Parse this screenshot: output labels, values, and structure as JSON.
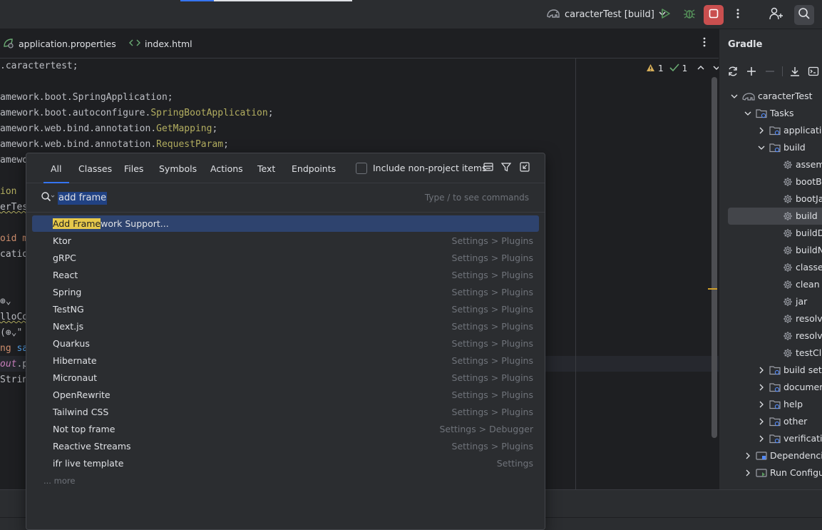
{
  "toolbar": {
    "run_config": "caracterTest [build]"
  },
  "editor_tabs": [
    {
      "label": "application.properties"
    },
    {
      "label": "index.html"
    }
  ],
  "editor": {
    "inspections": {
      "warnings": "1",
      "ok": "1"
    },
    "lines": [
      [
        {
          "t": ".caractertest;",
          "c": ""
        }
      ],
      [
        {
          "t": "",
          "c": ""
        }
      ],
      [
        {
          "t": "amework.boot.SpringApplication;",
          "c": ""
        }
      ],
      [
        {
          "t": "amework.boot.autoconfigure.",
          "c": ""
        },
        {
          "t": "SpringBootApplication",
          "c": "ann"
        },
        {
          "t": ";",
          "c": ""
        }
      ],
      [
        {
          "t": "amework.web.bind.annotation.",
          "c": ""
        },
        {
          "t": "GetMapping",
          "c": "ann"
        },
        {
          "t": ";",
          "c": ""
        }
      ],
      [
        {
          "t": "amework.web.bind.annotation.",
          "c": ""
        },
        {
          "t": "RequestParam",
          "c": "ann"
        },
        {
          "t": ";",
          "c": ""
        }
      ],
      [
        {
          "t": "amewo",
          "c": ""
        }
      ],
      [
        {
          "t": "",
          "c": ""
        }
      ],
      [
        {
          "t": "ion",
          "c": "ann"
        }
      ],
      [
        {
          "t": "erTes",
          "c": "wavy"
        }
      ],
      [
        {
          "t": "",
          "c": ""
        }
      ],
      [
        {
          "t": "oid m",
          "c": "kw"
        }
      ],
      [
        {
          "t": "catio",
          "c": ""
        }
      ],
      [
        {
          "t": "",
          "c": ""
        }
      ],
      [
        {
          "t": "",
          "c": ""
        }
      ],
      [
        {
          "t": "⊕⌄",
          "c": ""
        }
      ],
      [
        {
          "t": "lloCo",
          "c": "wavy"
        }
      ],
      [
        {
          "t": "(⊕⌄\"",
          "c": ""
        }
      ],
      [
        {
          "t": "ng ",
          "c": "kw"
        },
        {
          "t": "sa",
          "c": "fn"
        }
      ],
      [
        {
          "t": "out",
          "c": "fld"
        },
        {
          "t": ".p",
          "c": ""
        }
      ],
      [
        {
          "t": "Strin",
          "c": ""
        }
      ]
    ]
  },
  "gradle": {
    "title": "Gradle",
    "tree": [
      {
        "label": "caracterTest",
        "depth": 0,
        "arrow": "down",
        "icon": "gradle-elephant-icon"
      },
      {
        "label": "Tasks",
        "depth": 1,
        "arrow": "down",
        "icon": "folder-icon"
      },
      {
        "label": "application",
        "depth": 2,
        "arrow": "right",
        "icon": "folder-gear-icon"
      },
      {
        "label": "build",
        "depth": 2,
        "arrow": "down",
        "icon": "folder-gear-icon"
      },
      {
        "label": "assemble",
        "depth": 3,
        "arrow": "",
        "icon": "gear-icon"
      },
      {
        "label": "bootBuildImage",
        "depth": 3,
        "arrow": "",
        "icon": "gear-icon"
      },
      {
        "label": "bootJar",
        "depth": 3,
        "arrow": "",
        "icon": "gear-icon"
      },
      {
        "label": "build",
        "depth": 3,
        "arrow": "",
        "icon": "gear-icon",
        "selected": true
      },
      {
        "label": "buildDependents",
        "depth": 3,
        "arrow": "",
        "icon": "gear-icon"
      },
      {
        "label": "buildNeeded",
        "depth": 3,
        "arrow": "",
        "icon": "gear-icon"
      },
      {
        "label": "classes",
        "depth": 3,
        "arrow": "",
        "icon": "gear-icon"
      },
      {
        "label": "clean",
        "depth": 3,
        "arrow": "",
        "icon": "gear-icon"
      },
      {
        "label": "jar",
        "depth": 3,
        "arrow": "",
        "icon": "gear-icon"
      },
      {
        "label": "resolveMainClassName",
        "depth": 3,
        "arrow": "",
        "icon": "gear-icon"
      },
      {
        "label": "resolveTestMainClassName",
        "depth": 3,
        "arrow": "",
        "icon": "gear-icon"
      },
      {
        "label": "testClasses",
        "depth": 3,
        "arrow": "",
        "icon": "gear-icon"
      },
      {
        "label": "build setup",
        "depth": 2,
        "arrow": "right",
        "icon": "folder-gear-icon"
      },
      {
        "label": "documentation",
        "depth": 2,
        "arrow": "right",
        "icon": "folder-gear-icon"
      },
      {
        "label": "help",
        "depth": 2,
        "arrow": "right",
        "icon": "folder-gear-icon"
      },
      {
        "label": "other",
        "depth": 2,
        "arrow": "right",
        "icon": "folder-gear-icon"
      },
      {
        "label": "verification",
        "depth": 2,
        "arrow": "right",
        "icon": "folder-gear-icon"
      },
      {
        "label": "Dependencies",
        "depth": 1,
        "arrow": "right",
        "icon": "dependencies-icon"
      },
      {
        "label": "Run Configurations",
        "depth": 1,
        "arrow": "right",
        "icon": "run-configs-icon"
      }
    ]
  },
  "search_popup": {
    "tabs": [
      {
        "label": "All",
        "active": true
      },
      {
        "label": "Classes"
      },
      {
        "label": "Files"
      },
      {
        "label": "Symbols"
      },
      {
        "label": "Actions"
      },
      {
        "label": "Text"
      },
      {
        "label": "Endpoints"
      }
    ],
    "include_non_project_label": "Include non-project items",
    "include_non_project_checked": false,
    "query": "add frame",
    "hint": "Type / to see commands",
    "results": [
      {
        "hl": "Add Frame",
        "rest": "work Support...",
        "location": "",
        "selected": true
      },
      {
        "hl": "",
        "rest": "Ktor",
        "location": "Settings > Plugins"
      },
      {
        "hl": "",
        "rest": "gRPC",
        "location": "Settings > Plugins"
      },
      {
        "hl": "",
        "rest": "React",
        "location": "Settings > Plugins"
      },
      {
        "hl": "",
        "rest": "Spring",
        "location": "Settings > Plugins"
      },
      {
        "hl": "",
        "rest": "TestNG",
        "location": "Settings > Plugins"
      },
      {
        "hl": "",
        "rest": "Next.js",
        "location": "Settings > Plugins"
      },
      {
        "hl": "",
        "rest": "Quarkus",
        "location": "Settings > Plugins"
      },
      {
        "hl": "",
        "rest": "Hibernate",
        "location": "Settings > Plugins"
      },
      {
        "hl": "",
        "rest": "Micronaut",
        "location": "Settings > Plugins"
      },
      {
        "hl": "",
        "rest": "OpenRewrite",
        "location": "Settings > Plugins"
      },
      {
        "hl": "",
        "rest": "Tailwind CSS",
        "location": "Settings > Plugins"
      },
      {
        "hl": "",
        "rest": "Not top frame",
        "location": "Settings > Debugger"
      },
      {
        "hl": "",
        "rest": "Reactive Streams",
        "location": "Settings > Plugins"
      },
      {
        "hl": "",
        "rest": "ifr live template",
        "location": "Settings"
      }
    ],
    "more_label": "... more"
  },
  "colors": {
    "accent": "#3574f0",
    "selection": "#2e436e",
    "match_highlight": "#e6c84b",
    "stop": "#c94f4f",
    "run": "#57965c"
  }
}
